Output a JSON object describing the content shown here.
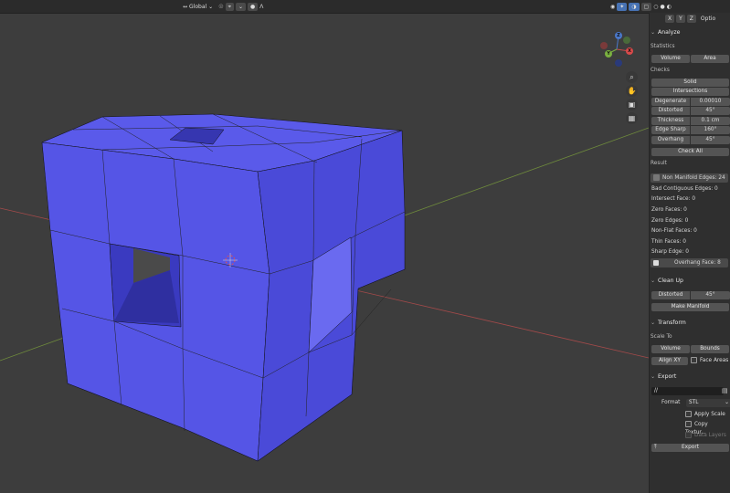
{
  "topbar": {
    "orientation": "Global",
    "snap_label": "⌘",
    "proportional": "Λ"
  },
  "axis": {
    "x": "X",
    "y": "Y",
    "z": "Z",
    "options": "Optio"
  },
  "analyze": {
    "title": "Analyze",
    "statistics_label": "Statistics",
    "volume": "Volume",
    "area": "Area",
    "checks_label": "Checks",
    "solid": "Solid",
    "intersections": "Intersections",
    "fields": [
      {
        "key": "Degenerate",
        "value": "0.00010"
      },
      {
        "key": "Distorted",
        "value": "45°"
      },
      {
        "key": "Thickness",
        "value": "0.1 cm"
      },
      {
        "key": "Edge Sharp",
        "value": "160°"
      },
      {
        "key": "Overhang",
        "value": "45°"
      }
    ],
    "check_all": "Check All",
    "result_label": "Result",
    "results": [
      "Non Manifold Edges: 24",
      "Bad Contiguous Edges: 0",
      "Intersect Face: 0",
      "Zero Faces: 0",
      "Zero Edges: 0",
      "Non-Flat Faces: 0",
      "Thin Faces: 0",
      "Sharp Edge: 0",
      "Overhang Face: 8"
    ]
  },
  "cleanup": {
    "title": "Clean Up",
    "distorted": "Distorted",
    "distorted_value": "45°",
    "make_manifold": "Make Manifold"
  },
  "transform": {
    "title": "Transform",
    "scale_to": "Scale To",
    "volume": "Volume",
    "bounds": "Bounds",
    "align_xy": "Align XY",
    "face_areas": "Face Areas"
  },
  "export": {
    "title": "Export",
    "path": "//",
    "format_label": "Format",
    "format_value": "STL",
    "apply_scale": "Apply Scale",
    "copy_textures": "Copy Textur...",
    "data_layers": "Data Layers",
    "export_btn": "Export"
  },
  "gizmo": {
    "x": "X",
    "y": "Y",
    "z": "Z"
  }
}
